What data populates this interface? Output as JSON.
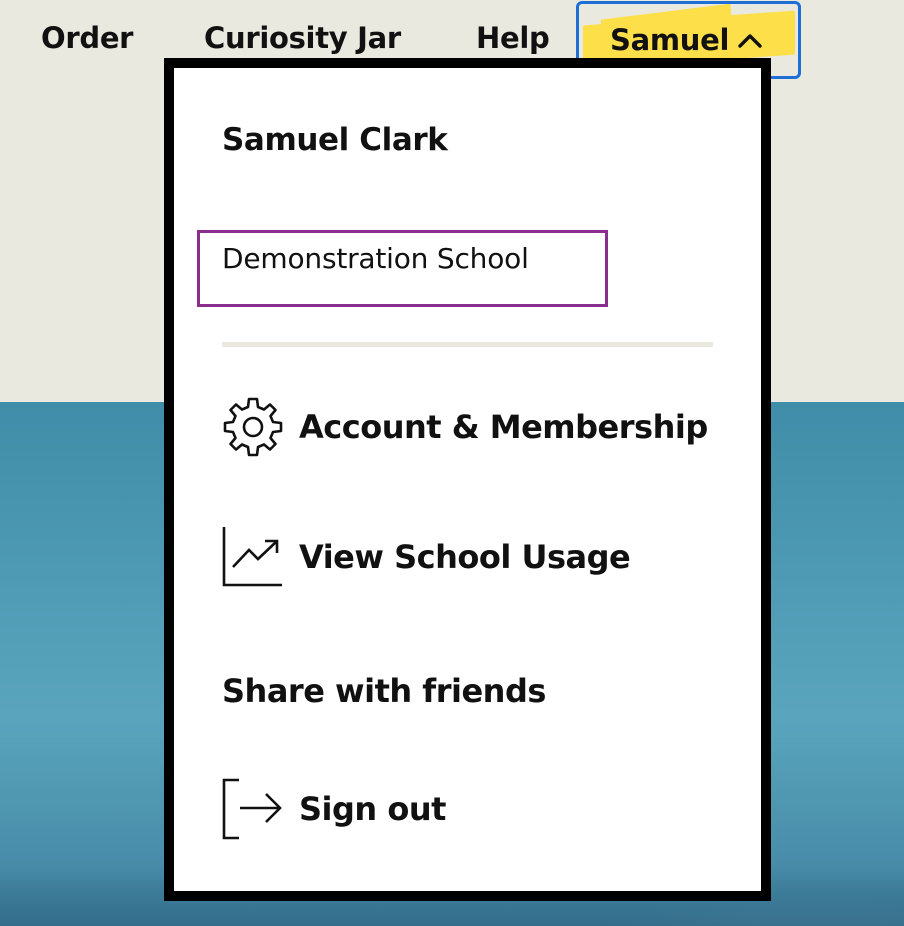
{
  "nav": {
    "order_label": "Order",
    "curiosity_jar_label": "Curiosity Jar",
    "help_label": "Help",
    "user_menu_label": "Samuel"
  },
  "user_menu": {
    "full_name": "Samuel Clark",
    "school_name": "Demonstration School",
    "items": [
      {
        "label": "Account & Membership",
        "icon": "gear-icon"
      },
      {
        "label": "View School Usage",
        "icon": "trending-up-chart-icon"
      },
      {
        "label": "Share with friends",
        "icon": ""
      },
      {
        "label": "Sign out",
        "icon": "sign-out-icon"
      }
    ]
  },
  "colors": {
    "highlight_yellow": "#fddf4a",
    "focus_blue": "#1d6fd6",
    "selection_purple": "#8b2c8f",
    "page_background": "#e9e9df",
    "sea_blue": "#4f9bb5"
  }
}
